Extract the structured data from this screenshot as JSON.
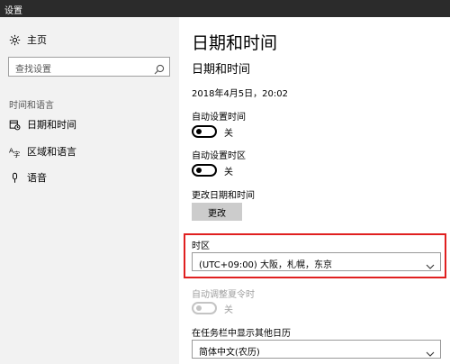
{
  "window": {
    "title": "设置"
  },
  "sidebar": {
    "home_label": "主页",
    "search_placeholder": "查找设置",
    "section_label": "时间和语言",
    "items": [
      {
        "label": "日期和时间",
        "icon": "calendar-clock-icon",
        "active": true
      },
      {
        "label": "区域和语言",
        "icon": "region-language-icon",
        "active": false
      },
      {
        "label": "语音",
        "icon": "microphone-icon",
        "active": false
      }
    ]
  },
  "main": {
    "page_title": "日期和时间",
    "section_title": "日期和时间",
    "current_datetime": "2018年4月5日，20:02",
    "auto_time": {
      "label": "自动设置时间",
      "state": "关"
    },
    "auto_timezone": {
      "label": "自动设置时区",
      "state": "关"
    },
    "change_datetime": {
      "label": "更改日期和时间",
      "button": "更改"
    },
    "timezone": {
      "label": "时区",
      "value": "(UTC+09:00) 大阪，札幌，东京"
    },
    "dst": {
      "label": "自动调整夏令时",
      "state": "关",
      "disabled": true
    },
    "calendar": {
      "label": "在任务栏中显示其他日历",
      "value": "简体中文(农历)"
    }
  },
  "colors": {
    "highlight": "#e02020",
    "sidebar_bg": "#f2f2f2",
    "titlebar_bg": "#2b2b2b"
  }
}
